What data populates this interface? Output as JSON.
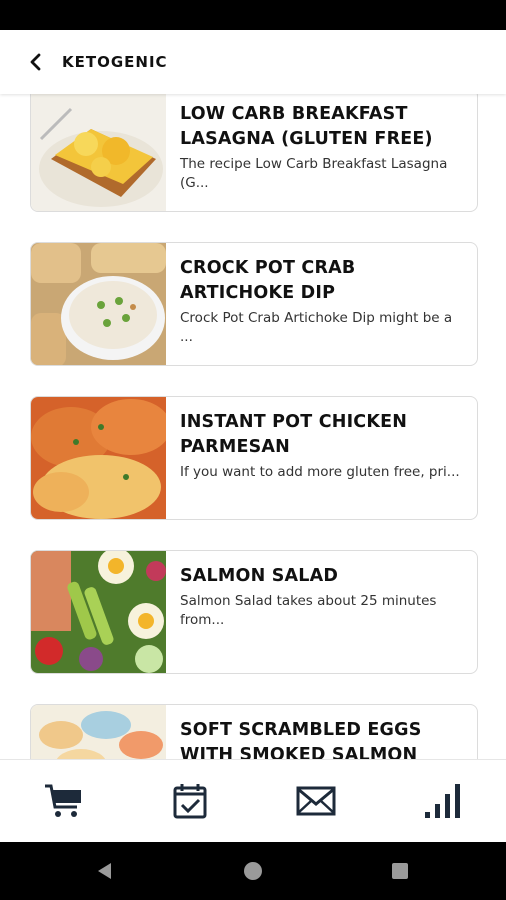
{
  "header": {
    "title": "KETOGENIC",
    "back_icon": "chevron-left-icon"
  },
  "recipes": [
    {
      "title": "LOW CARB BREAKFAST LASAGNA (GLUTEN FREE)",
      "description": "The recipe Low Carb Breakfast Lasagna (G..."
    },
    {
      "title": "CROCK POT CRAB ARTICHOKE DIP",
      "description": "Crock Pot Crab Artichoke Dip might be a ..."
    },
    {
      "title": "INSTANT POT CHICKEN PARMESAN",
      "description": "If you want to add more gluten free, pri..."
    },
    {
      "title": "SALMON SALAD",
      "description": "Salmon Salad takes about 25 minutes from..."
    },
    {
      "title": "SOFT SCRAMBLED EGGS WITH SMOKED SALMON",
      "description": ""
    }
  ],
  "bottom_nav": {
    "items": [
      "cart-icon",
      "calendar-check-icon",
      "mail-icon",
      "bar-chart-icon"
    ]
  },
  "system_nav": [
    "back-triangle-icon",
    "home-circle-icon",
    "recents-square-icon"
  ],
  "colors": {
    "text": "#111111",
    "card_border": "#dcdcdc",
    "bar": "#000000"
  }
}
